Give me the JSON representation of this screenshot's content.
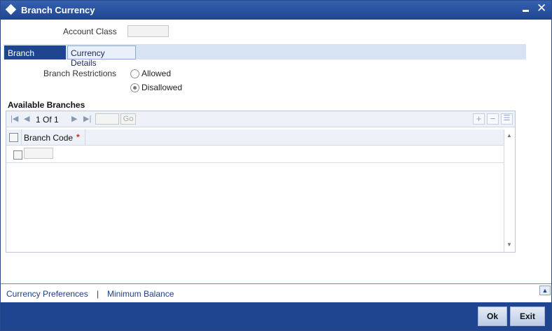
{
  "window": {
    "title": "Branch Currency"
  },
  "account_class": {
    "label": "Account Class",
    "value": ""
  },
  "tabs": [
    {
      "label": "Branch Details",
      "active": true
    },
    {
      "label": "Currency Details",
      "active": false
    }
  ],
  "branch_restrictions": {
    "label": "Branch Restrictions",
    "options": [
      {
        "label": "Allowed",
        "selected": false
      },
      {
        "label": "Disallowed",
        "selected": true
      }
    ]
  },
  "available_branches": {
    "title": "Available Branches",
    "pagination": {
      "current": "1",
      "of_label": "Of",
      "total": "1",
      "go_label": "Go"
    },
    "columns": [
      {
        "label": "Branch Code",
        "required_marker": "*"
      }
    ],
    "rows": [
      {
        "branch_code": ""
      }
    ]
  },
  "footer_links": {
    "currency_preferences": "Currency Preferences",
    "separator": "|",
    "minimum_balance": "Minimum Balance"
  },
  "buttons": {
    "ok": "Ok",
    "exit": "Exit"
  },
  "colors": {
    "titlebar": "#1f4590",
    "accent": "#1f4590",
    "required": "#dd2222"
  },
  "icons": [
    "diamond-icon",
    "minimize-icon",
    "close-icon",
    "first-page-icon",
    "prev-page-icon",
    "next-page-icon",
    "last-page-icon",
    "add-row-icon",
    "delete-row-icon",
    "single-view-icon",
    "scroll-up-icon",
    "scroll-down-icon",
    "collapse-up-icon"
  ]
}
